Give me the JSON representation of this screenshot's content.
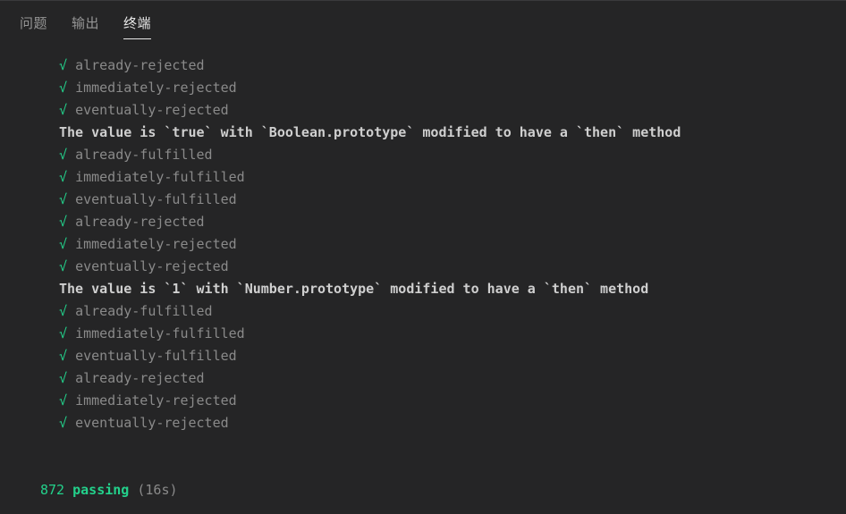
{
  "panel": {
    "tabs": [
      {
        "id": "problems",
        "label": "问题",
        "active": false
      },
      {
        "id": "output",
        "label": "输出",
        "active": false
      },
      {
        "id": "terminal",
        "label": "终端",
        "active": true
      }
    ]
  },
  "colors": {
    "background": "#252526",
    "pass_green": "#23d18b",
    "test_gray": "#8a8a8a",
    "suite_white": "#cfcfcf",
    "tab_inactive": "#969696",
    "tab_active": "#e7e7e7"
  },
  "terminal": {
    "check_glyph": "√",
    "lines": [
      {
        "kind": "test",
        "tick": "√",
        "text": "already-rejected"
      },
      {
        "kind": "test",
        "tick": "√",
        "text": "immediately-rejected"
      },
      {
        "kind": "test",
        "tick": "√",
        "text": "eventually-rejected"
      },
      {
        "kind": "suite",
        "text": "The value is `true` with `Boolean.prototype` modified to have a `then` method"
      },
      {
        "kind": "test",
        "tick": "√",
        "text": "already-fulfilled"
      },
      {
        "kind": "test",
        "tick": "√",
        "text": "immediately-fulfilled"
      },
      {
        "kind": "test",
        "tick": "√",
        "text": "eventually-fulfilled"
      },
      {
        "kind": "test",
        "tick": "√",
        "text": "already-rejected"
      },
      {
        "kind": "test",
        "tick": "√",
        "text": "immediately-rejected"
      },
      {
        "kind": "test",
        "tick": "√",
        "text": "eventually-rejected"
      },
      {
        "kind": "suite",
        "text": "The value is `1` with `Number.prototype` modified to have a `then` method"
      },
      {
        "kind": "test",
        "tick": "√",
        "text": "already-fulfilled"
      },
      {
        "kind": "test",
        "tick": "√",
        "text": "immediately-fulfilled"
      },
      {
        "kind": "test",
        "tick": "√",
        "text": "eventually-fulfilled"
      },
      {
        "kind": "test",
        "tick": "√",
        "text": "already-rejected"
      },
      {
        "kind": "test",
        "tick": "√",
        "text": "immediately-rejected"
      },
      {
        "kind": "test",
        "tick": "√",
        "text": "eventually-rejected"
      },
      {
        "kind": "blank",
        "text": ""
      },
      {
        "kind": "blank",
        "text": ""
      },
      {
        "kind": "summary",
        "count": "872",
        "word": "passing",
        "duration": "(16s)"
      }
    ]
  }
}
